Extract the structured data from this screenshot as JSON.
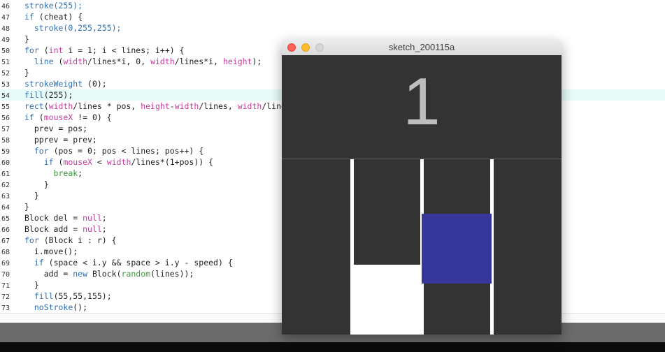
{
  "editor": {
    "lines": [
      {
        "num": "46",
        "tokens": [
          {
            "t": "stroke(255);",
            "c": "t-blue"
          }
        ]
      },
      {
        "num": "47",
        "tokens": [
          {
            "t": "if",
            "c": "t-blue"
          },
          {
            "t": " (cheat) {",
            "c": "t-default"
          }
        ]
      },
      {
        "num": "48",
        "tokens": [
          {
            "t": "  ",
            "c": "t-default"
          },
          {
            "t": "stroke(0,255,255);",
            "c": "t-blue"
          }
        ]
      },
      {
        "num": "49",
        "tokens": [
          {
            "t": "}",
            "c": "t-default"
          }
        ]
      },
      {
        "num": "50",
        "tokens": [
          {
            "t": "for",
            "c": "t-blue"
          },
          {
            "t": " (",
            "c": "t-default"
          },
          {
            "t": "int",
            "c": "t-pink"
          },
          {
            "t": " i = 1; i < lines; i++) {",
            "c": "t-default"
          }
        ]
      },
      {
        "num": "51",
        "tokens": [
          {
            "t": "  ",
            "c": "t-default"
          },
          {
            "t": "line",
            "c": "t-blue"
          },
          {
            "t": " (",
            "c": "t-default"
          },
          {
            "t": "width",
            "c": "t-pink"
          },
          {
            "t": "/lines*i, 0, ",
            "c": "t-default"
          },
          {
            "t": "width",
            "c": "t-pink"
          },
          {
            "t": "/lines*i, ",
            "c": "t-default"
          },
          {
            "t": "height",
            "c": "t-pink"
          },
          {
            "t": ");",
            "c": "t-default"
          }
        ]
      },
      {
        "num": "52",
        "tokens": [
          {
            "t": "}",
            "c": "t-default"
          }
        ]
      },
      {
        "num": "53",
        "tokens": [
          {
            "t": "strokeWeight",
            "c": "t-blue"
          },
          {
            "t": " (0);",
            "c": "t-default"
          }
        ]
      },
      {
        "num": "54",
        "tokens": [
          {
            "t": "fill",
            "c": "t-blue"
          },
          {
            "t": "(255);",
            "c": "t-default"
          }
        ]
      },
      {
        "num": "55",
        "tokens": [
          {
            "t": "rect",
            "c": "t-blue"
          },
          {
            "t": "(",
            "c": "t-default"
          },
          {
            "t": "width",
            "c": "t-pink"
          },
          {
            "t": "/lines * pos, ",
            "c": "t-default"
          },
          {
            "t": "height",
            "c": "t-pink"
          },
          {
            "t": "-",
            "c": "t-default"
          },
          {
            "t": "width",
            "c": "t-pink"
          },
          {
            "t": "/lines, ",
            "c": "t-default"
          },
          {
            "t": "width",
            "c": "t-pink"
          },
          {
            "t": "/lines, width/lines);",
            "c": "t-default"
          }
        ]
      },
      {
        "num": "56",
        "tokens": [
          {
            "t": "if",
            "c": "t-blue"
          },
          {
            "t": " (",
            "c": "t-default"
          },
          {
            "t": "mouseX",
            "c": "t-pink"
          },
          {
            "t": " != 0) {",
            "c": "t-default"
          }
        ]
      },
      {
        "num": "57",
        "tokens": [
          {
            "t": "  prev = pos;",
            "c": "t-default"
          }
        ]
      },
      {
        "num": "58",
        "tokens": [
          {
            "t": "  pprev = prev;",
            "c": "t-default"
          }
        ]
      },
      {
        "num": "59",
        "tokens": [
          {
            "t": "  ",
            "c": "t-default"
          },
          {
            "t": "for",
            "c": "t-blue"
          },
          {
            "t": " (pos = 0; pos < lines; pos++) {",
            "c": "t-default"
          }
        ]
      },
      {
        "num": "60",
        "tokens": [
          {
            "t": "    ",
            "c": "t-default"
          },
          {
            "t": "if",
            "c": "t-blue"
          },
          {
            "t": " (",
            "c": "t-default"
          },
          {
            "t": "mouseX",
            "c": "t-pink"
          },
          {
            "t": " < ",
            "c": "t-default"
          },
          {
            "t": "width",
            "c": "t-pink"
          },
          {
            "t": "/lines*(1+pos)) {",
            "c": "t-default"
          }
        ]
      },
      {
        "num": "61",
        "tokens": [
          {
            "t": "      ",
            "c": "t-default"
          },
          {
            "t": "break",
            "c": "t-green"
          },
          {
            "t": ";",
            "c": "t-default"
          }
        ]
      },
      {
        "num": "62",
        "tokens": [
          {
            "t": "    }",
            "c": "t-default"
          }
        ]
      },
      {
        "num": "63",
        "tokens": [
          {
            "t": "  }",
            "c": "t-default"
          }
        ]
      },
      {
        "num": "64",
        "tokens": [
          {
            "t": "}",
            "c": "t-default"
          }
        ]
      },
      {
        "num": "65",
        "tokens": [
          {
            "t": "Block del = ",
            "c": "t-default"
          },
          {
            "t": "null",
            "c": "t-pink"
          },
          {
            "t": ";",
            "c": "t-default"
          }
        ]
      },
      {
        "num": "66",
        "tokens": [
          {
            "t": "Block add = ",
            "c": "t-default"
          },
          {
            "t": "null",
            "c": "t-pink"
          },
          {
            "t": ";",
            "c": "t-default"
          }
        ]
      },
      {
        "num": "67",
        "tokens": [
          {
            "t": "for",
            "c": "t-blue"
          },
          {
            "t": " (Block i : r) {",
            "c": "t-default"
          }
        ]
      },
      {
        "num": "68",
        "tokens": [
          {
            "t": "  i.move();",
            "c": "t-default"
          }
        ]
      },
      {
        "num": "69",
        "tokens": [
          {
            "t": "  ",
            "c": "t-default"
          },
          {
            "t": "if",
            "c": "t-blue"
          },
          {
            "t": " (space < i.y && space > i.y - speed) {",
            "c": "t-default"
          }
        ]
      },
      {
        "num": "70",
        "tokens": [
          {
            "t": "    add = ",
            "c": "t-default"
          },
          {
            "t": "new",
            "c": "t-blue"
          },
          {
            "t": " Block(",
            "c": "t-default"
          },
          {
            "t": "random",
            "c": "t-green"
          },
          {
            "t": "(lines));",
            "c": "t-default"
          }
        ]
      },
      {
        "num": "71",
        "tokens": [
          {
            "t": "  }",
            "c": "t-default"
          }
        ]
      },
      {
        "num": "72",
        "tokens": [
          {
            "t": "  ",
            "c": "t-default"
          },
          {
            "t": "fill",
            "c": "t-blue"
          },
          {
            "t": "(55,55,155);",
            "c": "t-default"
          }
        ]
      },
      {
        "num": "73",
        "tokens": [
          {
            "t": "  ",
            "c": "t-default"
          },
          {
            "t": "noStroke",
            "c": "t-blue"
          },
          {
            "t": "();",
            "c": "t-default"
          }
        ]
      }
    ],
    "highlighted_line": "54"
  },
  "sketch": {
    "title": "sketch_200115a",
    "score": "1",
    "colors": {
      "background": "#333333",
      "lane_line": "#ffffff",
      "player_block": "#ffffff",
      "falling_block": "#37379b"
    }
  }
}
